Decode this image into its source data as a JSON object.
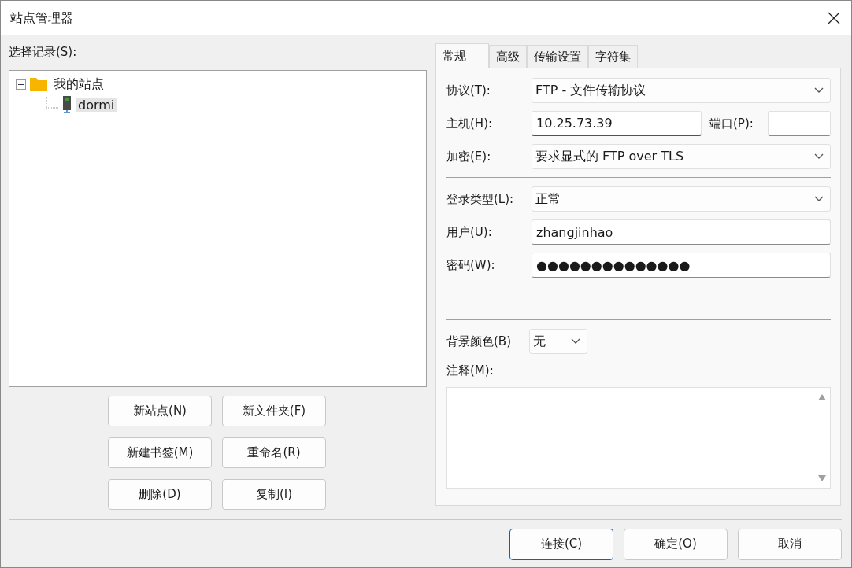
{
  "window": {
    "title": "站点管理器"
  },
  "tree": {
    "label": "选择记录(S):",
    "items": [
      {
        "label": "我的站点",
        "expanded": true,
        "kind": "folder",
        "selected": false,
        "children": [
          {
            "label": "dormi",
            "kind": "site",
            "selected": true
          }
        ]
      }
    ]
  },
  "site_buttons": [
    "新站点(N)",
    "新文件夹(F)",
    "新建书签(M)",
    "重命名(R)",
    "删除(D)",
    "复制(I)"
  ],
  "tabs": [
    {
      "label": "常规",
      "selected": true
    },
    {
      "label": "高级",
      "selected": false
    },
    {
      "label": "传输设置",
      "selected": false
    },
    {
      "label": "字符集",
      "selected": false
    }
  ],
  "general": {
    "rows": [
      {
        "label": "协议(T):",
        "kind": "select",
        "value": "FTP - 文件传输协议"
      },
      {
        "label": "主机(H):",
        "kind": "host",
        "value": "10.25.73.39",
        "focused": true,
        "port_label": "端口(P):"
      },
      {
        "label": "加密(E):",
        "kind": "select",
        "value": "要求显式的 FTP over TLS"
      },
      {
        "kind": "separator"
      },
      {
        "label": "登录类型(L):",
        "kind": "select",
        "value": "正常"
      },
      {
        "label": "用户(U):",
        "kind": "input",
        "value": "zhangjinhao"
      },
      {
        "label": "密码(W):",
        "kind": "password",
        "value": "●●●●●●●●●●●●●●"
      }
    ],
    "background_color": {
      "label": "背景颜色(B)",
      "value": "无"
    },
    "comments": {
      "label": "注释(M):"
    }
  },
  "footer_buttons": [
    {
      "label": "连接(C)",
      "default": true
    },
    {
      "label": "确定(O)",
      "default": false
    },
    {
      "label": "取消",
      "default": false
    }
  ]
}
